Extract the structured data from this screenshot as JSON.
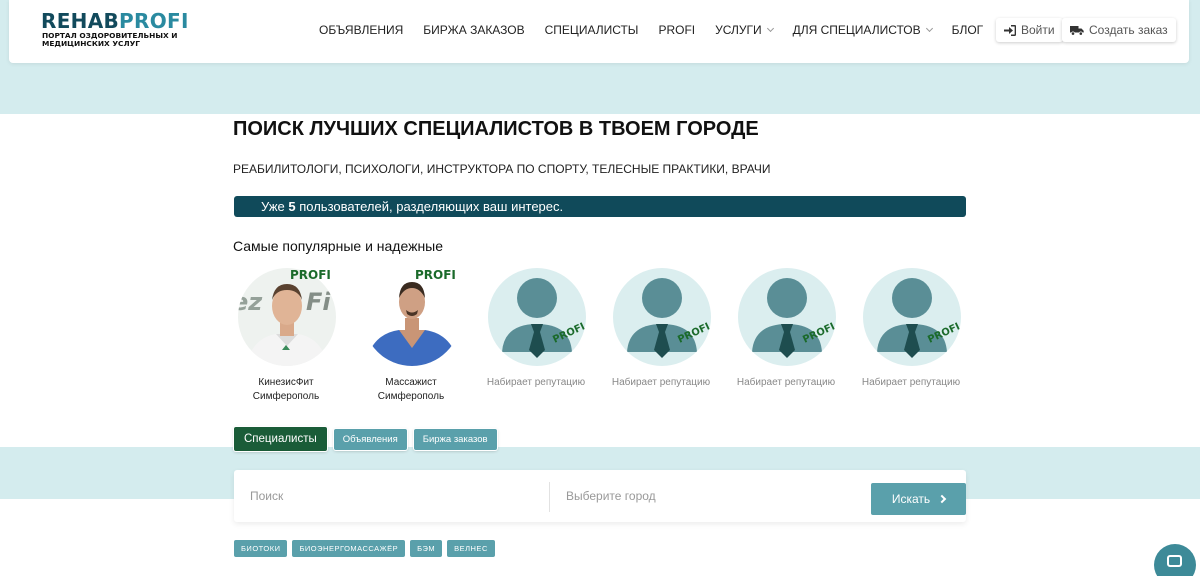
{
  "logo": {
    "title_a": "REHAB",
    "title_b": "PROFI",
    "subtitle": "ПОРТАЛ ОЗДОРОВИТЕЛЬНЫХ И МЕДИЦИНСКИХ УСЛУГ"
  },
  "nav": {
    "items": [
      {
        "label": "ОБЪЯВЛЕНИЯ",
        "dropdown": false
      },
      {
        "label": "БИРЖА ЗАКАЗОВ",
        "dropdown": false
      },
      {
        "label": "СПЕЦИАЛИСТЫ",
        "dropdown": false
      },
      {
        "label": "PROFI",
        "dropdown": false
      },
      {
        "label": "УСЛУГИ",
        "dropdown": true
      },
      {
        "label": "ДЛЯ СПЕЦИАЛИСТОВ",
        "dropdown": true
      },
      {
        "label": "БЛОГ",
        "dropdown": false
      }
    ]
  },
  "header_buttons": {
    "login": "Войти",
    "create_order": "Создать заказ"
  },
  "hero": {
    "title": "ПОИСК ЛУЧШИХ СПЕЦИАЛИСТОВ В ТВОЕМ ГОРОДЕ",
    "subtitle": "РЕАБИЛИТОЛОГИ, ПСИХОЛОГИ, ИНСТРУКТОРА ПО СПОРТУ, ТЕЛЕСНЫЕ ПРАКТИКИ, ВРАЧИ",
    "info_prefix": "Уже ",
    "info_count": "5",
    "info_suffix": " пользователей, разделяющих ваш интерес."
  },
  "popular": {
    "title": "Самые популярные и надежные",
    "badge": "PROFI",
    "specialists": [
      {
        "name": "КинезисФит",
        "city": "Симферополь",
        "photo": "trainer-photo"
      },
      {
        "name": "Массажист",
        "city": "Симферополь",
        "photo": "masseur-photo"
      },
      {
        "name": "Набирает репутацию",
        "city": "",
        "photo": "placeholder"
      },
      {
        "name": "Набирает репутацию",
        "city": "",
        "photo": "placeholder"
      },
      {
        "name": "Набирает репутацию",
        "city": "",
        "photo": "placeholder"
      },
      {
        "name": "Набирает репутацию",
        "city": "",
        "photo": "placeholder"
      }
    ]
  },
  "tabs": [
    {
      "label": "Специалисты",
      "active": true
    },
    {
      "label": "Объявления",
      "active": false
    },
    {
      "label": "Биржа заказов",
      "active": false
    }
  ],
  "search": {
    "query_placeholder": "Поиск",
    "city_placeholder": "Выберите город",
    "button": "Искать"
  },
  "tags": [
    "БИОТОКИ",
    "БИОЭНЕРГОМАССАЖЁР",
    "БЭМ",
    "ВЕЛНЕС"
  ],
  "colors": {
    "primary": "#104a5a",
    "accent": "#5aa0ab",
    "active_tab": "#1a5c38",
    "band": "#d4ecee",
    "profi_badge": "#1a6a2a"
  }
}
